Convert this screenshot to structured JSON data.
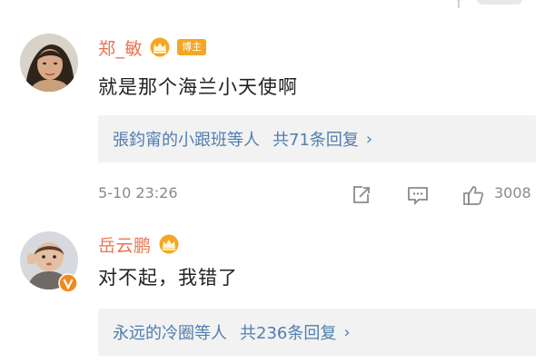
{
  "comments": [
    {
      "username": "郑_敏",
      "badge": "博主",
      "crown_icon": "crown-icon",
      "text": "就是那个海兰小天使啊",
      "reply_summary": {
        "names": "張鈞甯的小跟班等人",
        "count_text": "共71条回复",
        "arrow": "›"
      },
      "timestamp": "5-10 23:26",
      "actions": {
        "share_icon": "share-edit-icon",
        "comment_icon": "comment-icon",
        "like_icon": "thumbs-up-icon",
        "like_count": "3008"
      }
    },
    {
      "username": "岳云鹏",
      "crown_icon": "crown-icon",
      "verified_icon": "verified-v-icon",
      "text": "对不起，我错了",
      "reply_summary": {
        "names": "永远的冷圈等人",
        "count_text": "共236条回复",
        "arrow": "›"
      }
    }
  ],
  "colors": {
    "username": "#eb7350",
    "link": "#507daf",
    "crown": "#f5a623",
    "verified": "#f08a1f",
    "meta": "#8a8a8a",
    "reply_bg": "#f2f2f2"
  }
}
